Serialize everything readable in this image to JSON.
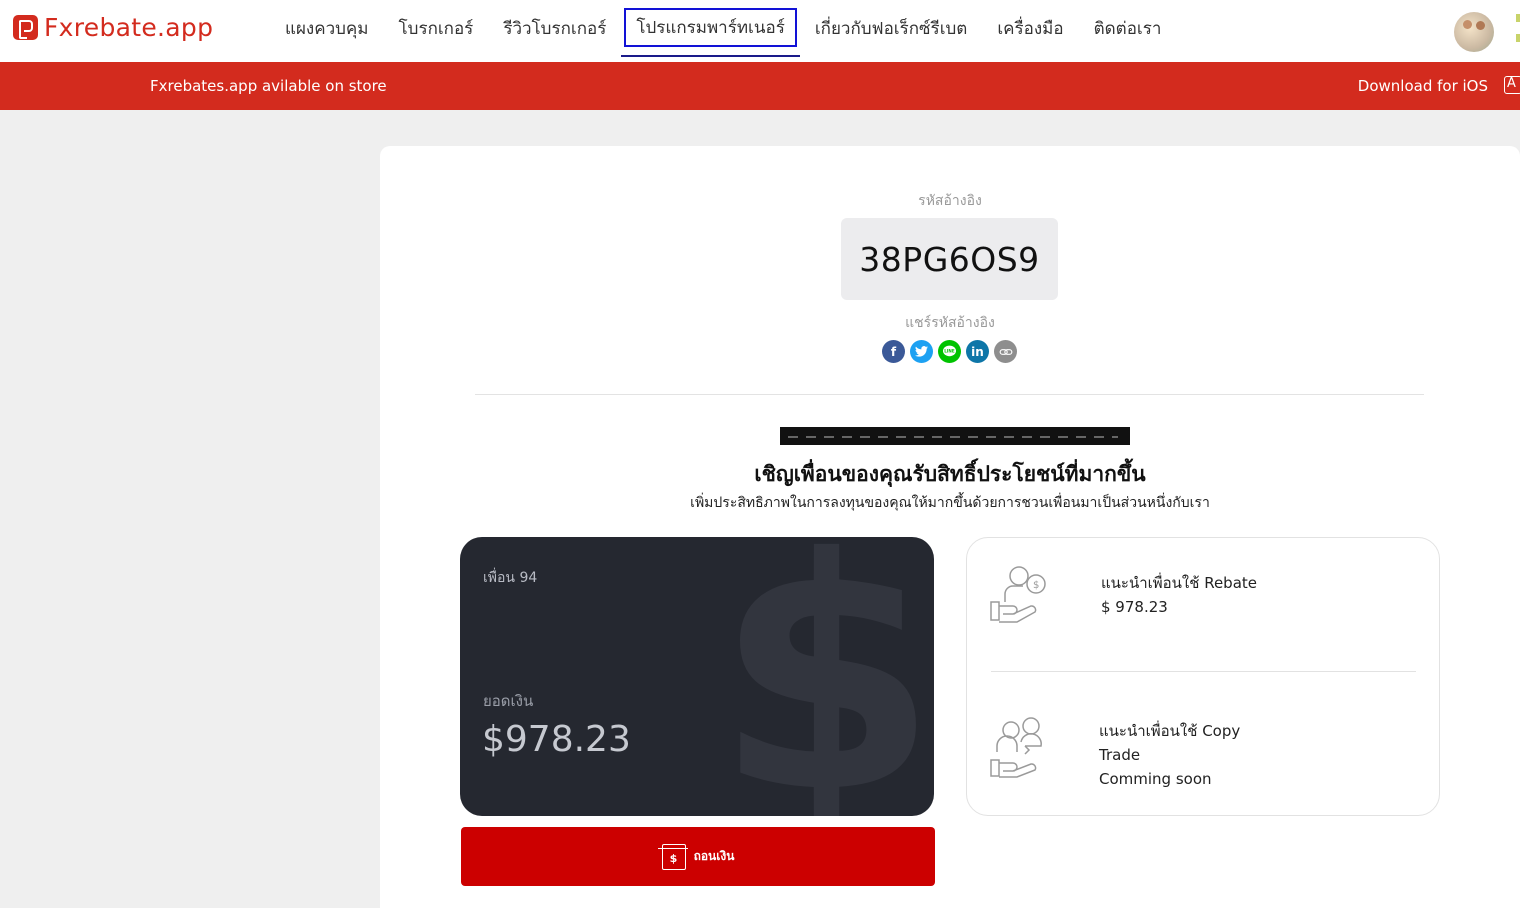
{
  "brand": {
    "name": "Fxrebate.app",
    "color": "#d32b1e"
  },
  "nav": {
    "items": [
      {
        "label": "แผงควบคุม"
      },
      {
        "label": "โบรกเกอร์"
      },
      {
        "label": "รีวิวโบรกเกอร์"
      },
      {
        "label": "โปรแกรมพาร์ทเนอร์",
        "active": true
      },
      {
        "label": "เกี่ยวกับฟอเร็กซ์รีเบต"
      },
      {
        "label": "เครื่องมือ"
      },
      {
        "label": "ติดต่อเรา"
      }
    ]
  },
  "banner": {
    "text": "Fxrebates.app avilable on store",
    "download_label": "Download for iOS"
  },
  "referral": {
    "label": "รหัสอ้างอิง",
    "code": "38PG6OS9",
    "share_label": "แชร์รหัสอ้างอิง",
    "share_icons": [
      "facebook-icon",
      "twitter-icon",
      "line-icon",
      "linkedin-icon",
      "link-icon"
    ]
  },
  "invite": {
    "headline": "เชิญเพื่อนของคุณรับสิทธิ์ประโยชน์ที่มากขึ้น",
    "subline": "เพิ่มประสิทธิภาพในการลงทุนของคุณให้มากขึ้นด้วยการชวนเพื่อนมาเป็นส่วนหนึ่งกับเรา"
  },
  "balance_card": {
    "friends": "เพื่อน 94",
    "balance_label": "ยอดเงิน",
    "balance": "$978.23"
  },
  "withdraw": {
    "label": "ถอนเงิน"
  },
  "rewards": {
    "rebate": {
      "title": "แนะนำเพื่อนใช้ Rebate",
      "amount": "$ 978.23"
    },
    "copy_trade": {
      "title_line1": "แนะนำเพื่อนใช้ Copy",
      "title_line2": "Trade",
      "status": "Comming soon"
    }
  },
  "colors": {
    "banner": "#d32b1e",
    "card": "#252830",
    "withdraw": "#cc0000",
    "active_outline": "#1212d6"
  }
}
